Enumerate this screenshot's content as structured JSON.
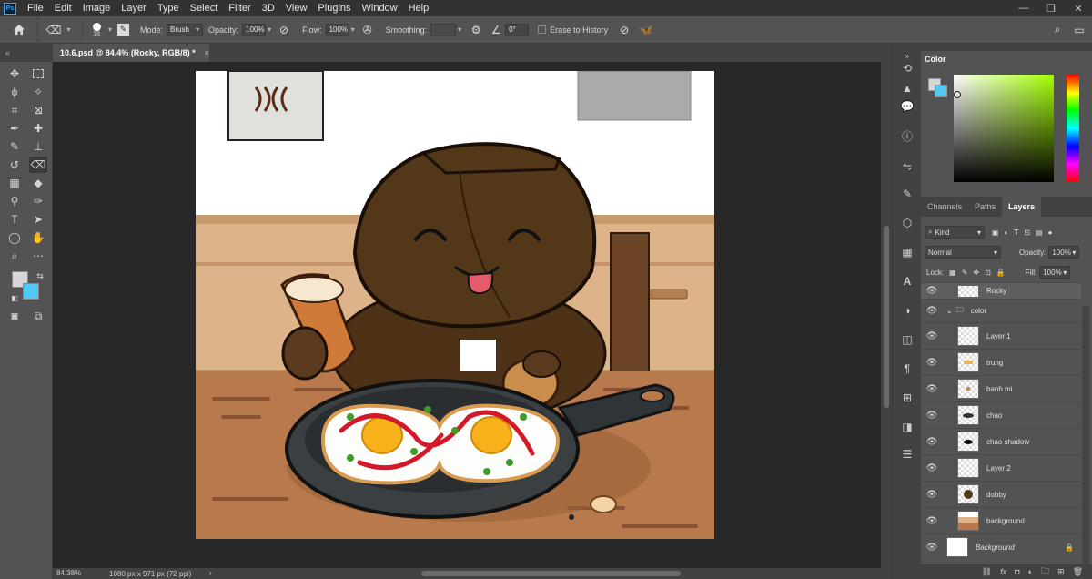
{
  "app": {
    "logo": "Ps"
  },
  "menu": [
    "File",
    "Edit",
    "Image",
    "Layer",
    "Type",
    "Select",
    "Filter",
    "3D",
    "View",
    "Plugins",
    "Window",
    "Help"
  ],
  "window_controls": [
    "—",
    "❐",
    "✕"
  ],
  "options": {
    "brush_size": "18",
    "mode_label": "Mode:",
    "mode_value": "Brush",
    "opacity_label": "Opacity:",
    "opacity_value": "100%",
    "flow_label": "Flow:",
    "flow_value": "100%",
    "smoothing_label": "Smoothing:",
    "smoothing_value": "",
    "angle_value": "0°",
    "erase_history_label": "Erase to History"
  },
  "document": {
    "tab_title": "10.6.psd @ 84.4% (Rocky, RGB/8) *",
    "close": "×"
  },
  "status": {
    "zoom": "84.38%",
    "doc_info": "1080 px x 971 px (72 ppi)",
    "arrow": "›"
  },
  "color_panel": {
    "tab": "Color",
    "foreground": "#d6d6d6",
    "background": "#53c8f2"
  },
  "layers_panel": {
    "tabs": [
      "Channels",
      "Paths",
      "Layers"
    ],
    "filter_kind": "Kind",
    "blend_mode": "Normal",
    "opacity_label": "Opacity:",
    "opacity_value": "100%",
    "lock_label": "Lock:",
    "fill_label": "Fill:",
    "fill_value": "100%",
    "layers": [
      {
        "name": "Rocky"
      },
      {
        "name": "color"
      },
      {
        "name": "Layer 1"
      },
      {
        "name": "trung"
      },
      {
        "name": "banh mi"
      },
      {
        "name": "chao"
      },
      {
        "name": "chao shadow"
      },
      {
        "name": "Layer 2"
      },
      {
        "name": "dobby"
      },
      {
        "name": "background"
      },
      {
        "name": "Background"
      }
    ],
    "footer_icons": [
      "link-icon",
      "fx-icon",
      "mask-icon",
      "adjustment-icon",
      "folder-icon",
      "new-layer-icon",
      "trash-icon"
    ]
  }
}
